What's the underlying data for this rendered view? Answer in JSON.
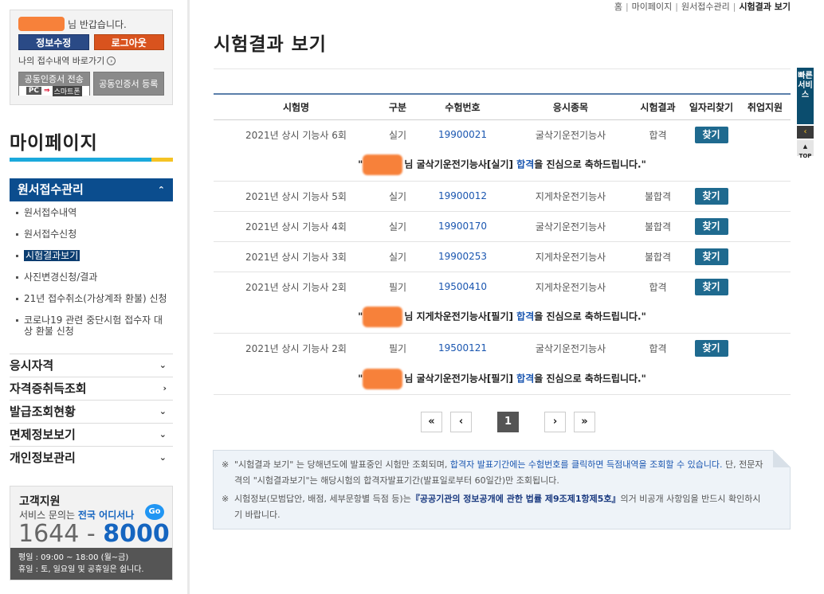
{
  "sidebar": {
    "welcome_text": "님 반갑습니다.",
    "btn_info": "정보수정",
    "btn_logout": "로그아웃",
    "shortcut": "나의 접수내역 바로가기",
    "cert_transfer": "공동인증서 전송",
    "cert_pc": "PC",
    "cert_smartphone": "스마트폰",
    "cert_register": "공동인증서 등록",
    "title": "마이페이지",
    "active_menu": "원서접수관리",
    "submenu": [
      "원서접수내역",
      "원서접수신청",
      "시험결과보기",
      "사진변경신청/결과",
      "21년 접수취소(가상계좌 환불) 신청",
      "코로나19 관련 중단시험 접수자 대상 환불 신청"
    ],
    "menu": [
      "응시자격",
      "자격증취득조회",
      "발급조회현황",
      "면제정보보기",
      "개인정보관리"
    ],
    "support": {
      "title": "고객지원",
      "desc_prefix": "서비스 문의는",
      "desc_highlight": "전국 어디서나",
      "go": "Go",
      "phone_prefix": "1644 - ",
      "phone_main": "8000",
      "hours1": "평일 : 09:00 ~ 18:00 (월~금)",
      "hours2": "휴일 : 토, 일요일 및 공휴일은 쉽니다."
    }
  },
  "breadcrumb": [
    "홈",
    "마이페이지",
    "원서접수관리",
    "시험결과 보기"
  ],
  "page_title": "시험결과 보기",
  "table": {
    "headers": [
      "시험명",
      "구분",
      "수험번호",
      "응시종목",
      "시험결과",
      "일자리찾기",
      "취업지원"
    ],
    "find_label": "찾기",
    "rows": [
      {
        "exam": "2021년 상시 기능사 6회",
        "type": "실기",
        "number": "19900021",
        "item": "굴삭기운전기능사",
        "result": "합격"
      },
      {
        "exam": "2021년 상시 기능사 5회",
        "type": "실기",
        "number": "19900012",
        "item": "지게차운전기능사",
        "result": "불합격"
      },
      {
        "exam": "2021년 상시 기능사 4회",
        "type": "실기",
        "number": "19900170",
        "item": "굴삭기운전기능사",
        "result": "불합격"
      },
      {
        "exam": "2021년 상시 기능사 3회",
        "type": "실기",
        "number": "19900253",
        "item": "지게차운전기능사",
        "result": "불합격"
      },
      {
        "exam": "2021년 상시 기능사 2회",
        "type": "필기",
        "number": "19500410",
        "item": "지게차운전기능사",
        "result": "합격"
      },
      {
        "exam": "2021년 상시 기능사 2회",
        "type": "필기",
        "number": "19500121",
        "item": "굴삭기운전기능사",
        "result": "합격"
      }
    ],
    "congrats": [
      {
        "pre": "\"",
        "mid": "님 굴삭기운전기능사[실기] ",
        "hl": "합격",
        "post": "을 진심으로 축하드립니다.\""
      },
      {
        "pre": "\"",
        "mid": "님 지게차운전기능사[필기] ",
        "hl": "합격",
        "post": "을 진심으로 축하드립니다.\""
      },
      {
        "pre": "\"",
        "mid": "님 굴삭기운전기능사[필기] ",
        "hl": "합격",
        "post": "을 진심으로 축하드립니다.\""
      }
    ]
  },
  "pager": {
    "first": "«",
    "prev": "‹",
    "current": "1",
    "next": "›",
    "last": "»"
  },
  "notice": {
    "mark": "※",
    "n1_a": "\"시험결과 보기\" 는 당해년도에 발표중인 시험만 조회되며, ",
    "n1_b": "합격자 발표기간에는 수험번호를 클릭하면 득점내역을 조회할 수 있습니다.",
    "n1_c": " 단, 전문자격의 \"시험결과보기\"는 해당시험의 합격자발표기간(발표일로부터 60일간)만 조회됩니다.",
    "n2_a": "시험정보(모범답안, 배점, 세부문항별 득점 등)는",
    "n2_b": "『공공기관의 정보공개에 관한 법률 제9조제1항제5호』",
    "n2_c": "의거 비공개 사항임을 반드시 확인하시기 바랍니다."
  },
  "quick": {
    "label": "빠른서비스",
    "top": "TOP"
  }
}
